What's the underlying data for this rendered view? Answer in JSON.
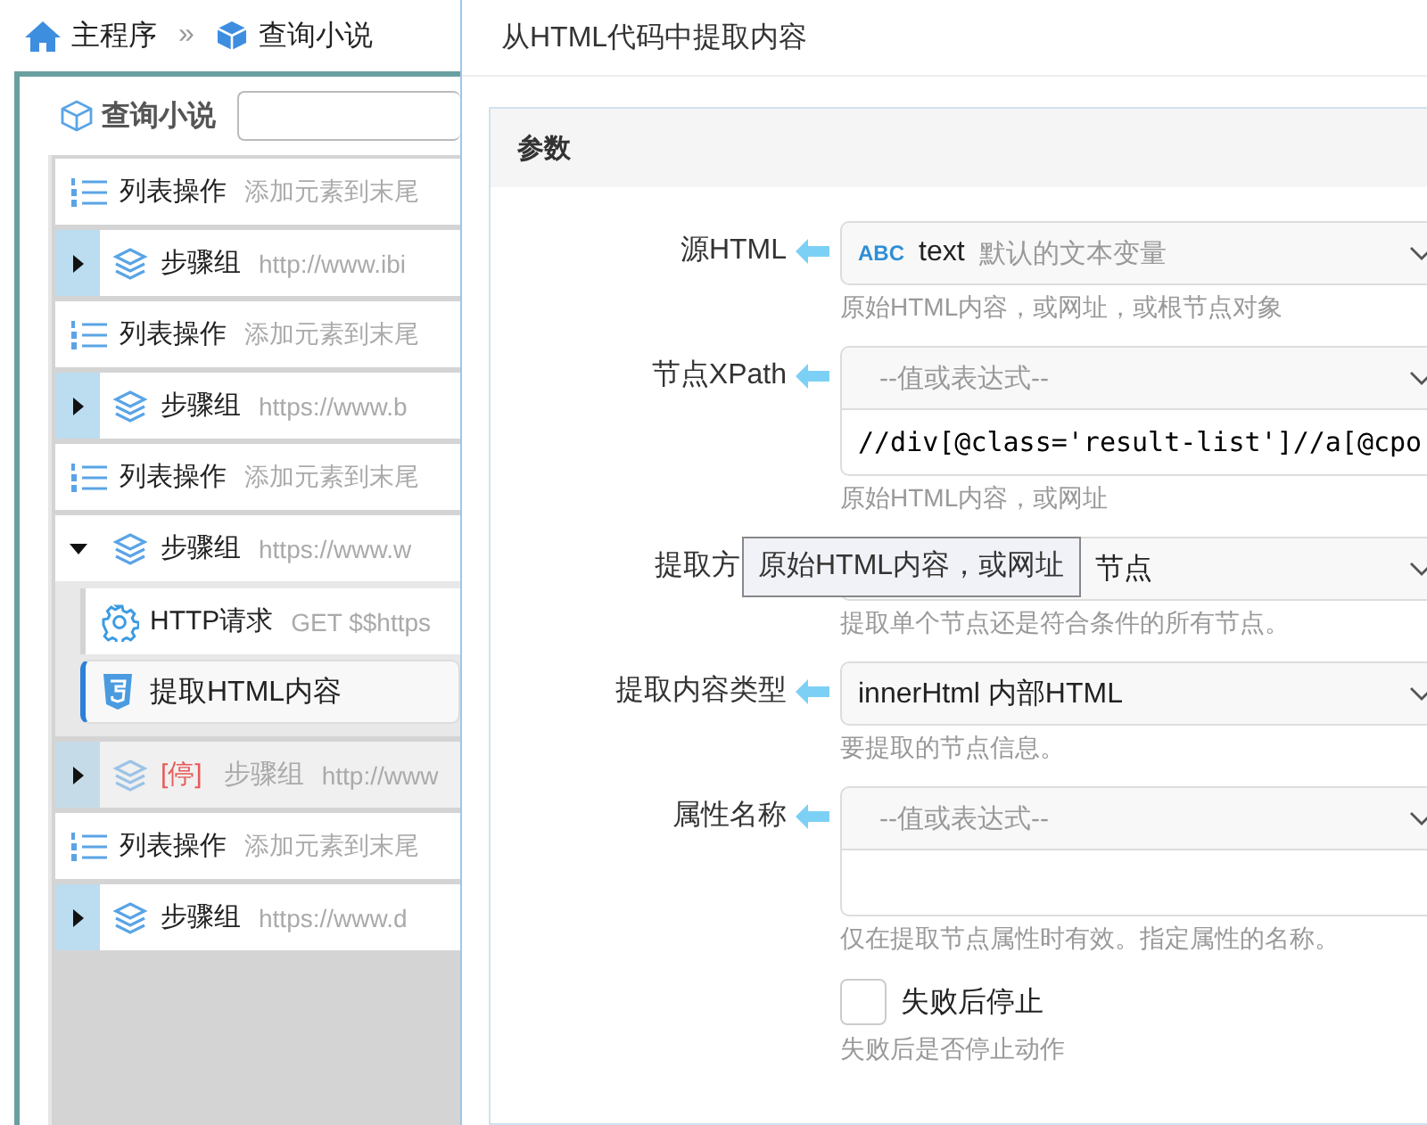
{
  "breadcrumb": [
    {
      "kind": "home",
      "label": "主程序"
    },
    {
      "kind": "cube",
      "label": "查询小说"
    }
  ],
  "breadcrumb_separator": "»",
  "panel": {
    "title": "查询小说"
  },
  "steps": [
    {
      "kind": "list",
      "name": "列表操作",
      "detail": "添加元素到末尾",
      "selected": false
    },
    {
      "kind": "group",
      "name": "步骤组",
      "detail": "http://www.ibi",
      "expanded": false,
      "disabled": false,
      "selected": false
    },
    {
      "kind": "list",
      "name": "列表操作",
      "detail": "添加元素到末尾",
      "selected": false
    },
    {
      "kind": "group",
      "name": "步骤组",
      "detail": "https://www.b",
      "expanded": false,
      "disabled": false,
      "selected": false
    },
    {
      "kind": "list",
      "name": "列表操作",
      "detail": "添加元素到末尾",
      "selected": false
    },
    {
      "kind": "group",
      "name": "步骤组",
      "detail": "https://www.w",
      "expanded": true,
      "disabled": false,
      "selected": false,
      "children": [
        {
          "kind": "http",
          "name": "HTTP请求",
          "detail": "GET $$https",
          "selected": false
        },
        {
          "kind": "html",
          "name": "提取HTML内容",
          "selected": true
        }
      ]
    },
    {
      "kind": "group",
      "name": "步骤组",
      "detail": "http://www",
      "stop_tag": "[停]",
      "expanded": false,
      "disabled": true,
      "selected": false
    },
    {
      "kind": "list",
      "name": "列表操作",
      "detail": "添加元素到末尾",
      "selected": false
    },
    {
      "kind": "group",
      "name": "步骤组",
      "detail": "https://www.d",
      "expanded": false,
      "disabled": false,
      "selected": false
    }
  ],
  "dialog": {
    "title": "从HTML代码中提取内容",
    "section": "参数",
    "fields": [
      {
        "kind": "variable",
        "label": "源HTML",
        "type_tag": "ABC",
        "value": "text",
        "note": "默认的文本变量",
        "hint": "原始HTML内容，或网址，或根节点对象"
      },
      {
        "kind": "expression",
        "label": "节点XPath",
        "placeholder": "--值或表达式--",
        "value": "//div[@class='result-list']//a[@cpo",
        "hint": "原始HTML内容，或网址"
      },
      {
        "kind": "select",
        "label": "提取方",
        "value": "节点",
        "tooltip": "原始HTML内容，或网址",
        "hint": "提取单个节点还是符合条件的所有节点。"
      },
      {
        "kind": "select",
        "label": "提取内容类型",
        "value": "innerHtml 内部HTML",
        "hint": "要提取的节点信息。"
      },
      {
        "kind": "expression",
        "label": "属性名称",
        "placeholder": "--值或表达式--",
        "hint": "仅在提取节点属性时有效。指定属性的名称。"
      },
      {
        "kind": "checkbox",
        "label": "失败后停止",
        "checked": false,
        "hint": "失败后是否停止动作"
      }
    ]
  }
}
